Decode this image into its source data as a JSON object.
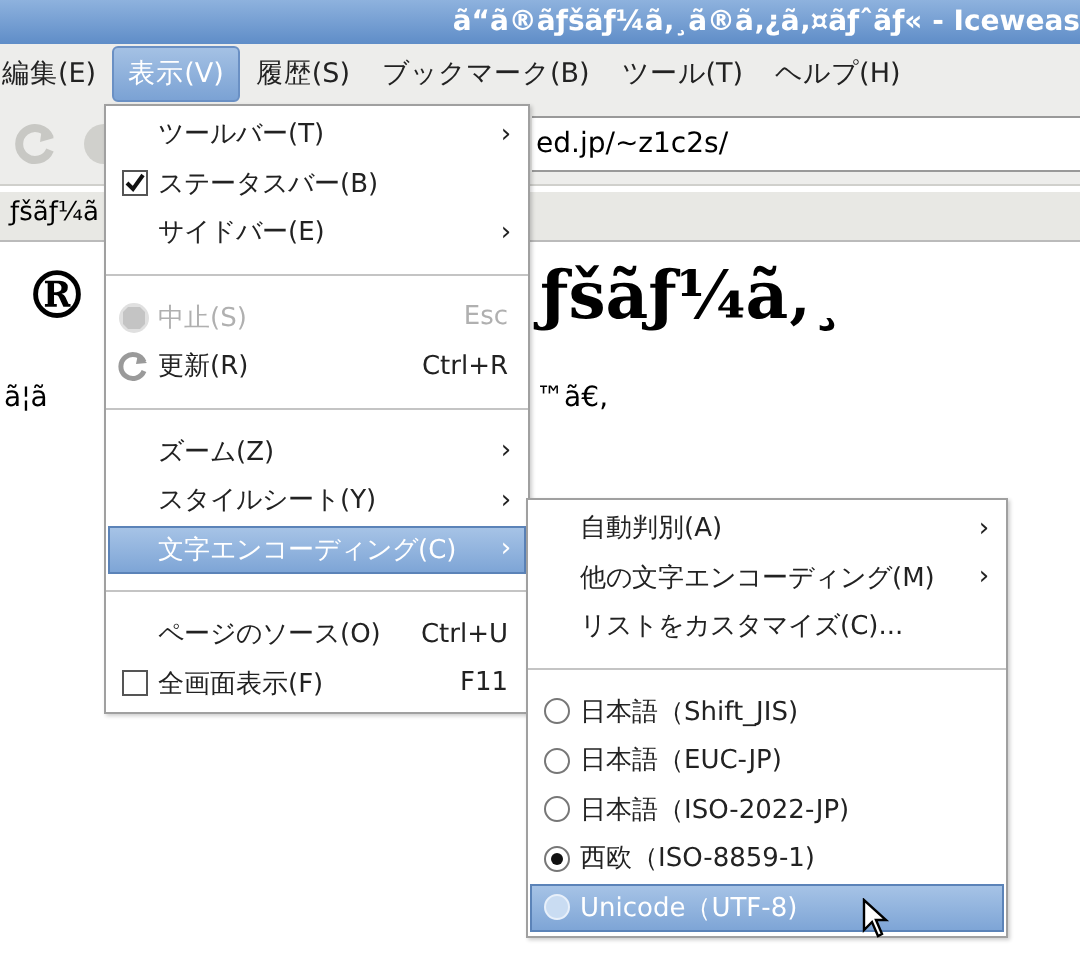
{
  "window": {
    "title": "ã“ã®ãƒšãƒ¼ã‚¸ã®ã‚¿ã‚¤ãƒˆãƒ« - Iceweas"
  },
  "menubar": [
    {
      "label": "編集(E)",
      "selected": false
    },
    {
      "label": "表示(V)",
      "selected": true
    },
    {
      "label": "履歴(S)",
      "selected": false
    },
    {
      "label": "ブックマーク(B)",
      "selected": false
    },
    {
      "label": "ツール(T)",
      "selected": false
    },
    {
      "label": "ヘルプ(H)",
      "selected": false
    }
  ],
  "toolbar": {
    "address": "ed.jp/~z1c2s/"
  },
  "tab": {
    "title": "ƒšãƒ¼ã"
  },
  "page": {
    "heading_left": "®",
    "heading_right": "ƒšãƒ¼ã‚¸",
    "text_left": "ã¦ã",
    "text_right": "™ã€‚"
  },
  "view_menu": [
    {
      "kind": "item",
      "label": "ツールバー(T)",
      "arrow": "›",
      "selected": false
    },
    {
      "kind": "check",
      "label": "ステータスバー(B)",
      "checked": true,
      "selected": false
    },
    {
      "kind": "item",
      "label": "サイドバー(E)",
      "arrow": "›",
      "selected": false
    },
    {
      "kind": "separator"
    },
    {
      "kind": "stop",
      "label": "中止(S)",
      "shortcut": "Esc",
      "disabled": true,
      "selected": false
    },
    {
      "kind": "reload",
      "label": "更新(R)",
      "shortcut": "Ctrl+R",
      "disabled": false,
      "selected": false
    },
    {
      "kind": "separator"
    },
    {
      "kind": "item",
      "label": "ズーム(Z)",
      "arrow": "›",
      "selected": false
    },
    {
      "kind": "item",
      "label": "スタイルシート(Y)",
      "arrow": "›",
      "selected": false
    },
    {
      "kind": "item",
      "label": "文字エンコーディング(C)",
      "arrow": "›",
      "selected": true
    },
    {
      "kind": "separator"
    },
    {
      "kind": "item",
      "label": "ページのソース(O)",
      "shortcut": "Ctrl+U",
      "selected": false
    },
    {
      "kind": "check",
      "label": "全画面表示(F)",
      "shortcut": "F11",
      "checked": false,
      "selected": false
    }
  ],
  "encoding_menu": [
    {
      "kind": "item",
      "label": "自動判別(A)",
      "arrow": "›",
      "selected": false
    },
    {
      "kind": "item",
      "label": "他の文字エンコーディング(M)",
      "arrow": "›",
      "selected": false
    },
    {
      "kind": "item",
      "label": "リストをカスタマイズ(C)...",
      "selected": false
    },
    {
      "kind": "separator"
    },
    {
      "kind": "radio",
      "label": "日本語（Shift_JIS)",
      "checked": false,
      "selected": false
    },
    {
      "kind": "radio",
      "label": "日本語（EUC-JP)",
      "checked": false,
      "selected": false
    },
    {
      "kind": "radio",
      "label": "日本語（ISO-2022-JP)",
      "checked": false,
      "selected": false
    },
    {
      "kind": "radio",
      "label": "西欧（ISO-8859-1)",
      "checked": true,
      "selected": false
    },
    {
      "kind": "radio",
      "label": "Unicode（UTF-8)",
      "checked": false,
      "selected": true
    }
  ]
}
